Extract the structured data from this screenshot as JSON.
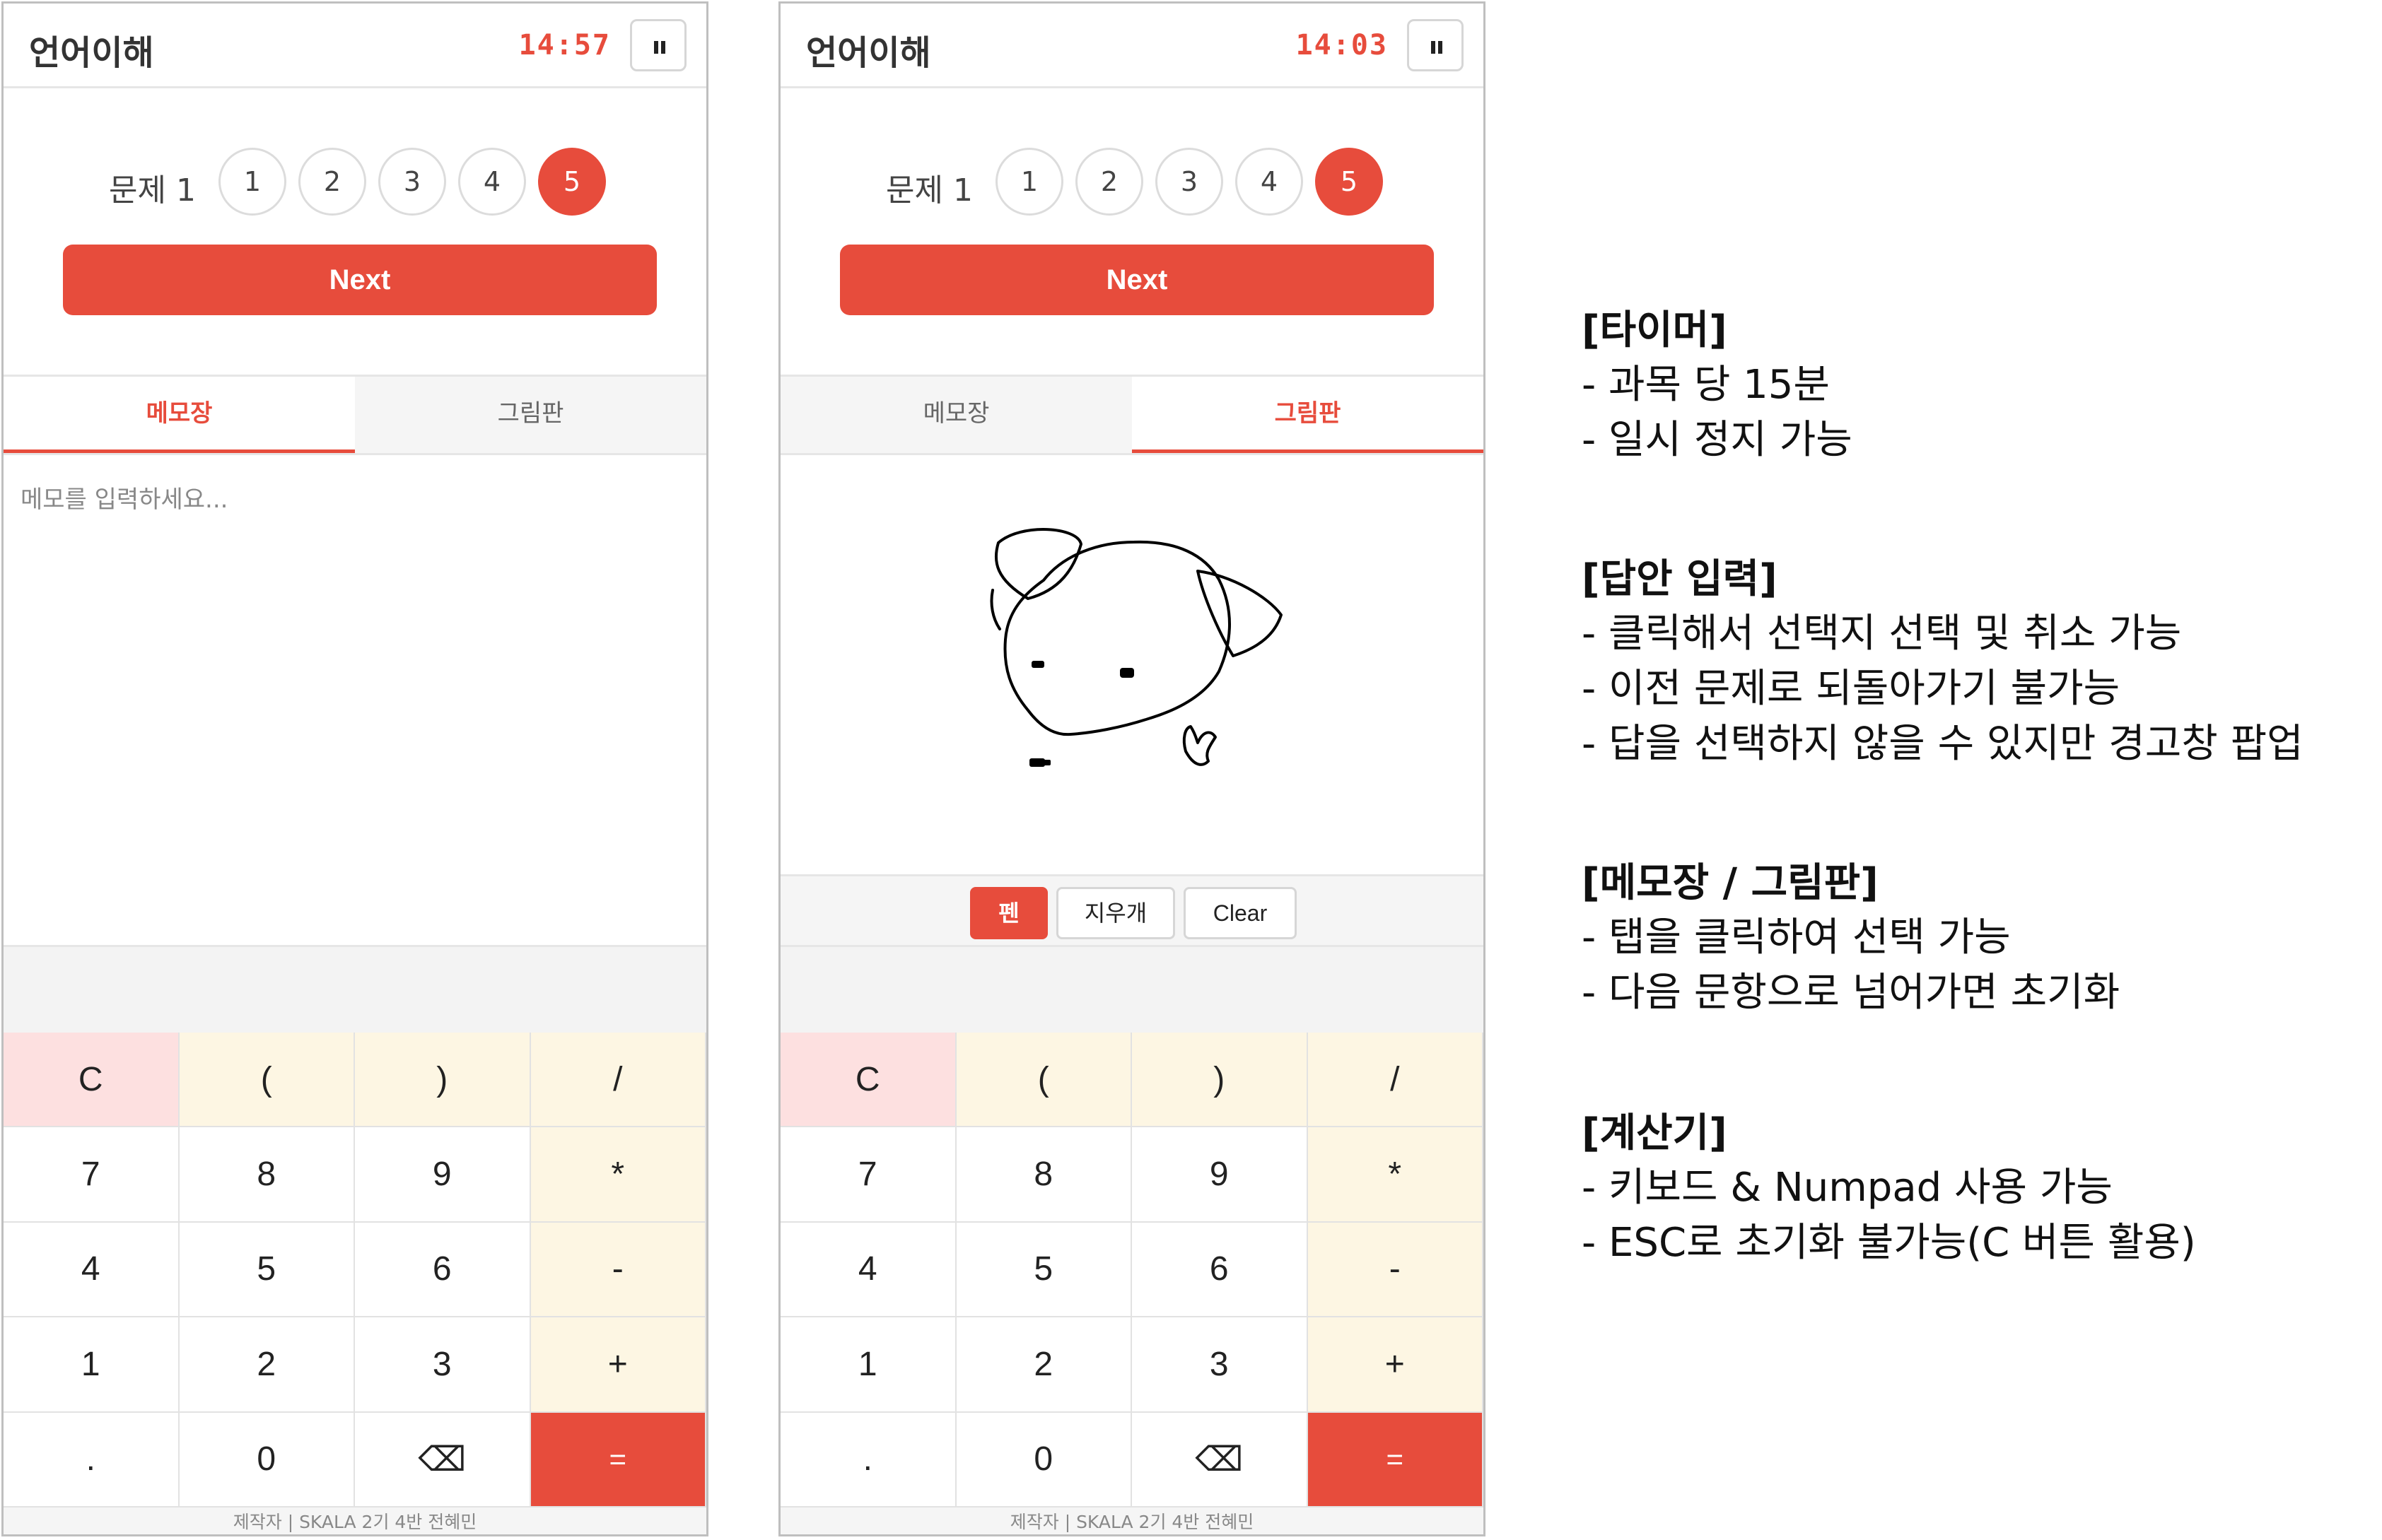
{
  "colors": {
    "accent": "#e74c3c",
    "operator_key_bg": "#fdf6e3",
    "clear_key_bg": "#fde0e0"
  },
  "panels": [
    {
      "subject": "언어이해",
      "timer": "14:57",
      "question_label": "문제 1",
      "questions": [
        "1",
        "2",
        "3",
        "4",
        "5"
      ],
      "selected_question": "5",
      "next_label": "Next",
      "tabs": {
        "memo": "메모장",
        "draw": "그림판"
      },
      "active_tab": "메모장",
      "memo_placeholder": "메모를 입력하세요...",
      "footer": "제작자 | SKALA 2기 4반 전혜민"
    },
    {
      "subject": "언어이해",
      "timer": "14:03",
      "question_label": "문제 1",
      "questions": [
        "1",
        "2",
        "3",
        "4",
        "5"
      ],
      "selected_question": "5",
      "next_label": "Next",
      "tabs": {
        "memo": "메모장",
        "draw": "그림판"
      },
      "active_tab": "그림판",
      "draw_tools": {
        "pen": "펜",
        "eraser": "지우개",
        "clear": "Clear"
      },
      "active_tool": "펜",
      "footer": "제작자 | SKALA 2기 4반 전혜민"
    }
  ],
  "calculator_keys": [
    "C",
    "(",
    ")",
    "/",
    "7",
    "8",
    "9",
    "*",
    "4",
    "5",
    "6",
    "-",
    "1",
    "2",
    "3",
    "+",
    ".",
    "0",
    "⌫",
    "="
  ],
  "notes": [
    {
      "heading": "[타이머]",
      "lines": [
        "- 과목 당 15분",
        "- 일시 정지 가능"
      ]
    },
    {
      "heading": "[답안 입력]",
      "lines": [
        "- 클릭해서 선택지 선택 및 취소 가능",
        "- 이전 문제로 되돌아가기 불가능",
        "- 답을 선택하지 않을 수 있지만 경고창 팝업"
      ]
    },
    {
      "heading": "[메모장 / 그림판]",
      "lines": [
        "- 탭을 클릭하여 선택 가능",
        "- 다음 문항으로 넘어가면 초기화"
      ]
    },
    {
      "heading": "[계산기]",
      "lines": [
        "- 키보드 & Numpad 사용 가능",
        "- ESC로 초기화 불가능(C 버튼 활용)"
      ]
    }
  ]
}
